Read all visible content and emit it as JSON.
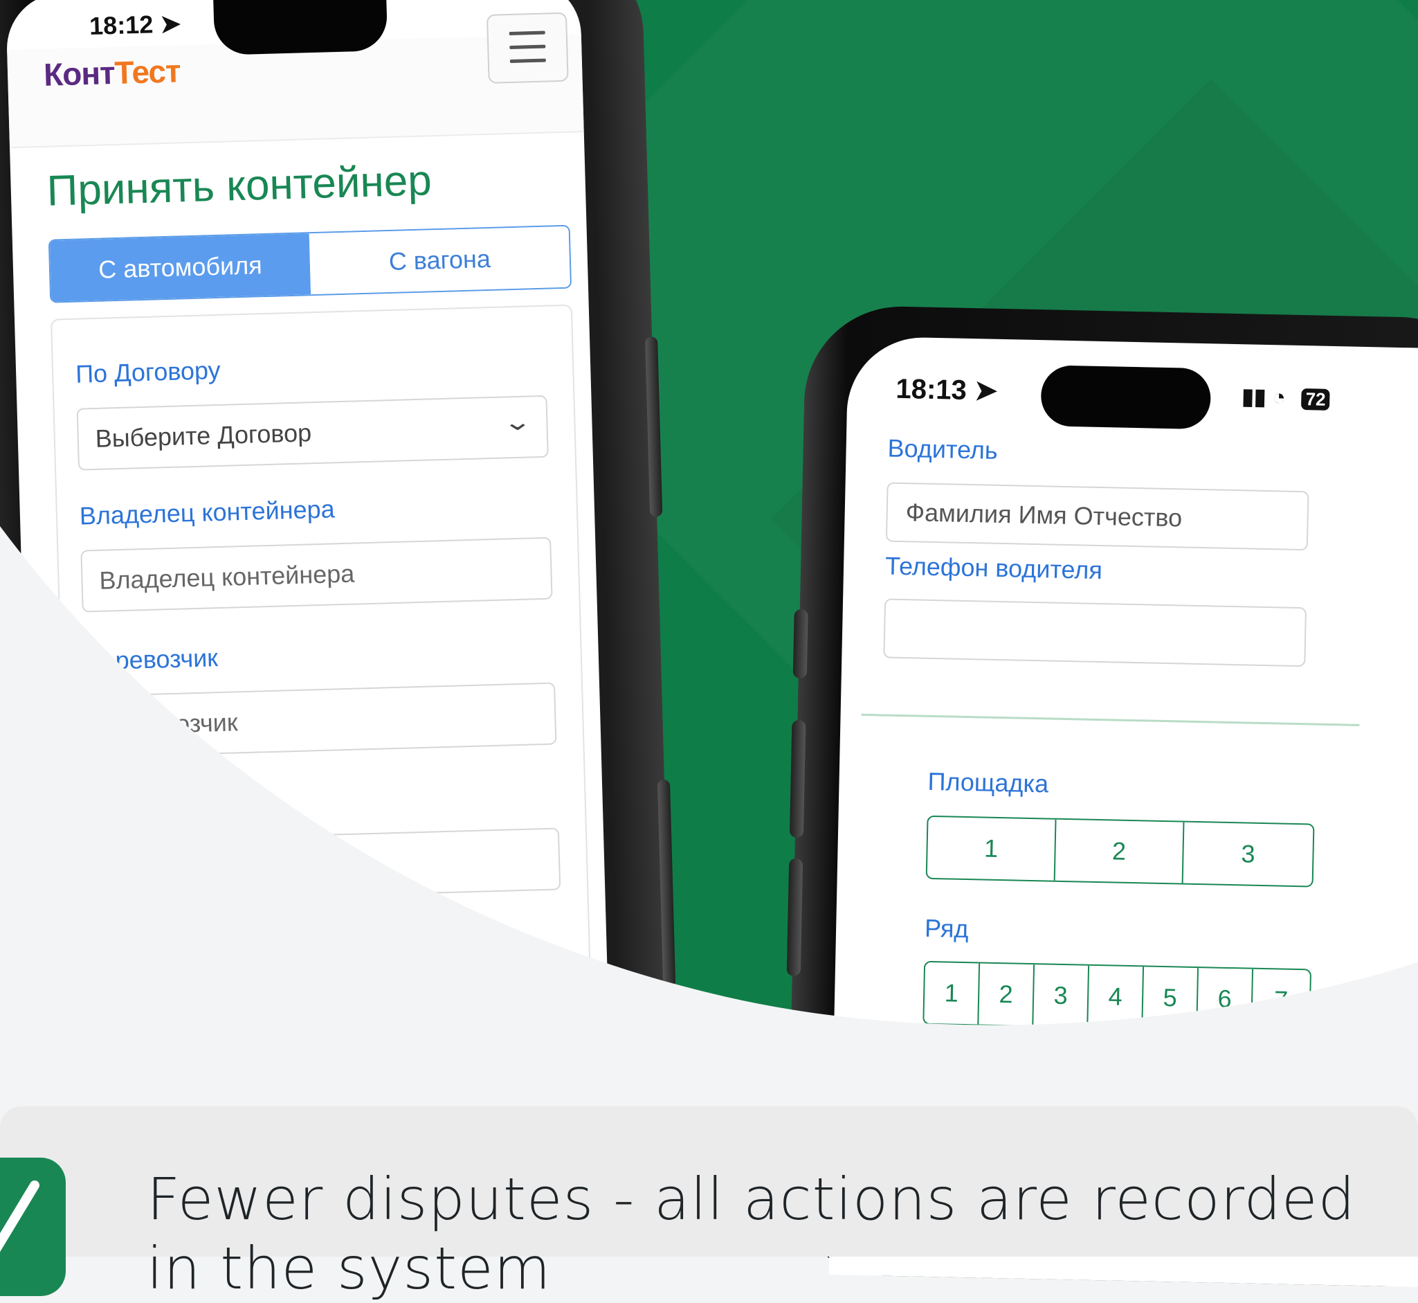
{
  "left_phone": {
    "status_time": "18:12",
    "brand": {
      "part1": "Конт",
      "part2": "Тест"
    },
    "page_title": "Принять контейнер",
    "tabs": {
      "active": "С автомобиля",
      "inactive": "С вагона"
    },
    "contract": {
      "label": "По Договору",
      "selected": "Выберите Договор"
    },
    "owner": {
      "label": "Владелец контейнера",
      "placeholder": "Владелец контейнера"
    },
    "carrier": {
      "label": "Перевозчик",
      "placeholder": "Перевозчик"
    }
  },
  "right_phone": {
    "status_time": "18:13",
    "battery": "72",
    "driver": {
      "label": "Водитель",
      "placeholder": "Фамилия Имя Отчество"
    },
    "driver_phone": {
      "label": "Телефон водителя",
      "value": ""
    },
    "site": {
      "label": "Площадка",
      "options": [
        "1",
        "2",
        "3"
      ]
    },
    "row": {
      "label": "Ряд",
      "options": [
        "1",
        "2",
        "3",
        "4",
        "5",
        "6",
        "7"
      ]
    }
  },
  "caption": "Fewer disputes - all actions are recorded in the system",
  "colors": {
    "green": "#0f7d47",
    "accent_blue": "#2c74d8",
    "bootstrap_green": "#198754"
  },
  "icons": [
    "location-arrow-icon",
    "hamburger-menu-icon",
    "chevron-down-icon",
    "signal-icon",
    "wifi-icon",
    "battery-icon",
    "checkmark-icon"
  ]
}
